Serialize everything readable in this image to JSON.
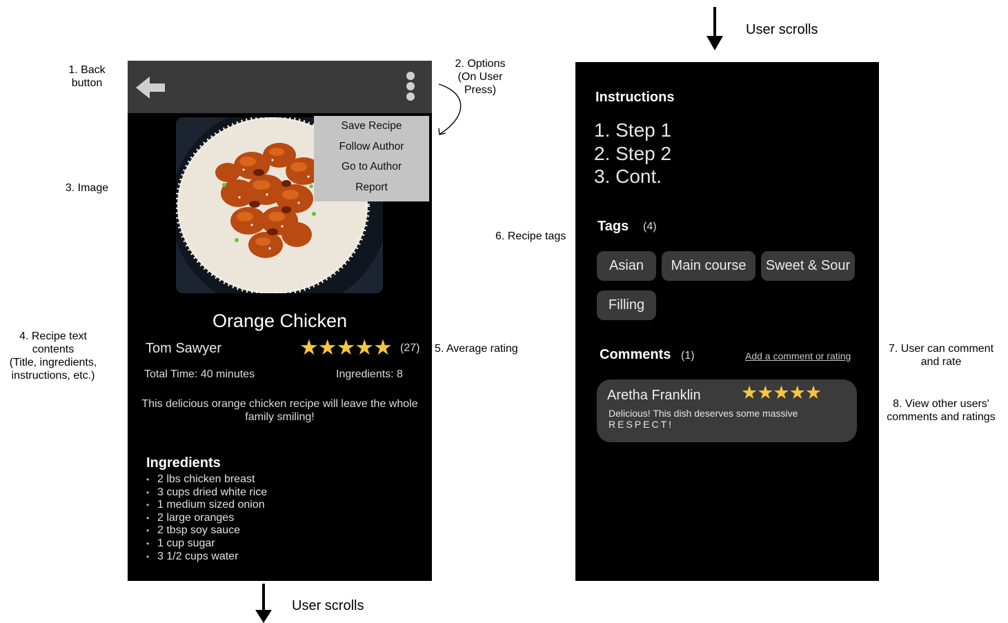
{
  "annotations": {
    "back_button": "1. Back\nbutton",
    "options": "2. Options\n(On User\nPress)",
    "image": "3. Image",
    "recipe_text": "4. Recipe text\ncontents\n(Title, ingredients,\ninstructions, etc.)",
    "average_rating": "5. Average rating",
    "recipe_tags": "6. Recipe tags",
    "comment_rate": "7. User can comment\nand rate",
    "view_comments": "8. View other users'\ncomments and ratings",
    "scroll_top": "User scrolls",
    "scroll_bottom": "User scrolls"
  },
  "screen1": {
    "options_menu": [
      "Save Recipe",
      "Follow Author",
      "Go to Author",
      "Report"
    ],
    "title": "Orange Chicken",
    "author": "Tom Sawyer",
    "rating_stars": "★★★★★",
    "rating_count": "(27)",
    "total_time": "Total Time: 40 minutes",
    "ingredients_count": "Ingredients: 8",
    "description": "This delicious orange chicken recipe will leave the whole family smiling!",
    "ingredients_title": "Ingredients",
    "ingredients": [
      "2 lbs chicken breast",
      "3 cups dried white rice",
      "1 medium sized onion",
      "2 large oranges",
      "2 tbsp soy sauce",
      "1 cup sugar",
      "3 1/2 cups water"
    ]
  },
  "screen2": {
    "instructions_title": "Instructions",
    "steps": [
      "1. Step 1",
      "2. Step 2",
      "3. Cont."
    ],
    "tags_title": "Tags",
    "tags_count": "(4)",
    "tags": [
      "Asian",
      "Main course",
      "Sweet & Sour",
      "Filling"
    ],
    "comments_title": "Comments",
    "comments_count": "(1)",
    "add_comment": "Add a comment or rating",
    "comment": {
      "author": "Aretha Franklin",
      "stars": "★★★★★",
      "text_line1": "Delicious! This dish deserves some massive",
      "text_line2": "RESPECT!"
    }
  },
  "colors": {
    "screen_bg": "#000000",
    "topbar_bg": "#3a3a3a",
    "menu_bg": "#c4c4c4",
    "chip_bg": "#3a3a3a",
    "star": "#f5c542"
  }
}
